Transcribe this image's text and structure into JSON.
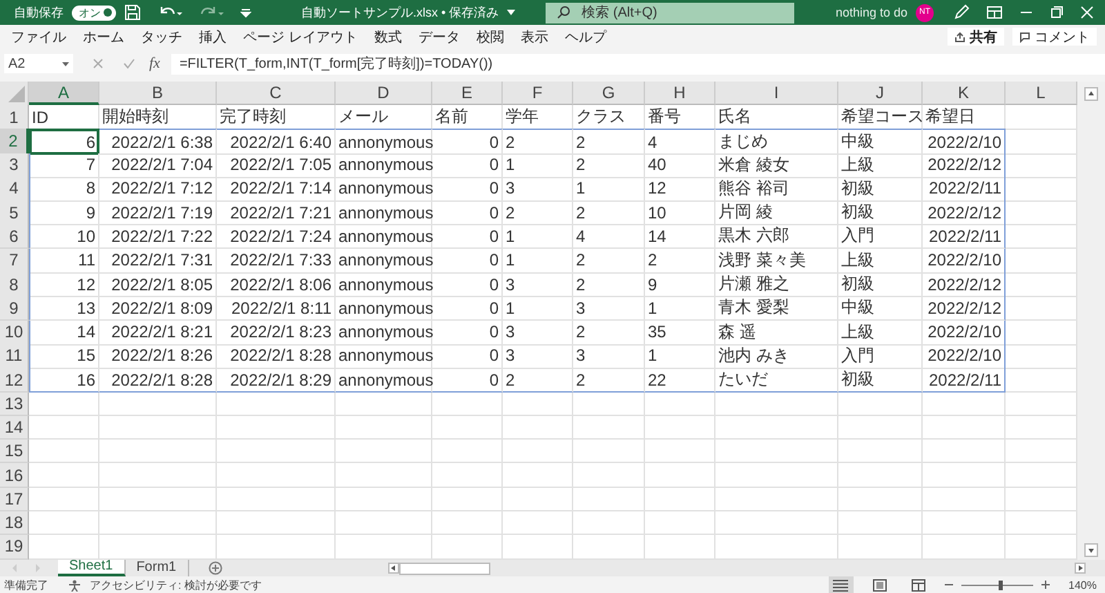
{
  "title_bar": {
    "autosave_label": "自動保存",
    "autosave_on": true,
    "toggle_label": "オン",
    "filename": "自動ソートサンプル.xlsx • 保存済み",
    "search_placeholder": "検索 (Alt+Q)",
    "user": "nothing to do",
    "avatar": "NT"
  },
  "ribbon": {
    "tabs": [
      "ファイル",
      "ホーム",
      "タッチ",
      "挿入",
      "ページ レイアウト",
      "数式",
      "データ",
      "校閲",
      "表示",
      "ヘルプ"
    ],
    "share": "共有",
    "comment": "コメント"
  },
  "formula_bar": {
    "name_box": "A2",
    "fx": "fx",
    "formula": "=FILTER(T_form,INT(T_form[完了時刻])=TODAY())"
  },
  "columns": [
    {
      "letter": "A",
      "kind": "number",
      "selected": true
    },
    {
      "letter": "B",
      "kind": "number",
      "selected": false
    },
    {
      "letter": "C",
      "kind": "number",
      "selected": false
    },
    {
      "letter": "D",
      "kind": "text",
      "selected": false
    },
    {
      "letter": "E",
      "kind": "number",
      "selected": false
    },
    {
      "letter": "F",
      "kind": "text",
      "selected": false
    },
    {
      "letter": "G",
      "kind": "text",
      "selected": false
    },
    {
      "letter": "H",
      "kind": "text",
      "selected": false
    },
    {
      "letter": "I",
      "kind": "text",
      "selected": false
    },
    {
      "letter": "J",
      "kind": "text",
      "selected": false
    },
    {
      "letter": "K",
      "kind": "number",
      "selected": false
    },
    {
      "letter": "L",
      "kind": "text",
      "selected": false
    }
  ],
  "rows": [
    {
      "number": "1",
      "selected": false,
      "in_spill": false,
      "cells": [
        "ID",
        "開始時刻",
        "完了時刻",
        "メール",
        "名前",
        "学年",
        "クラス",
        "番号",
        "氏名",
        "希望コース",
        "希望日"
      ],
      "header": true
    },
    {
      "number": "2",
      "selected": true,
      "in_spill": true,
      "cells": [
        "6",
        "2022/2/1 6:38",
        "2022/2/1 6:40",
        "annonymous",
        "0",
        "2",
        "2",
        "4",
        "まじめ",
        "中級",
        "2022/2/10"
      ]
    },
    {
      "number": "3",
      "selected": false,
      "in_spill": true,
      "cells": [
        "7",
        "2022/2/1 7:04",
        "2022/2/1 7:05",
        "annonymous",
        "0",
        "1",
        "2",
        "40",
        "米倉 綾女",
        "上級",
        "2022/2/12"
      ]
    },
    {
      "number": "4",
      "selected": false,
      "in_spill": true,
      "cells": [
        "8",
        "2022/2/1 7:12",
        "2022/2/1 7:14",
        "annonymous",
        "0",
        "3",
        "1",
        "12",
        "熊谷 裕司",
        "初級",
        "2022/2/11"
      ]
    },
    {
      "number": "5",
      "selected": false,
      "in_spill": true,
      "cells": [
        "9",
        "2022/2/1 7:19",
        "2022/2/1 7:21",
        "annonymous",
        "0",
        "2",
        "2",
        "10",
        "片岡 綾",
        "初級",
        "2022/2/12"
      ]
    },
    {
      "number": "6",
      "selected": false,
      "in_spill": true,
      "cells": [
        "10",
        "2022/2/1 7:22",
        "2022/2/1 7:24",
        "annonymous",
        "0",
        "1",
        "4",
        "14",
        "黒木 六郎",
        "入門",
        "2022/2/11"
      ]
    },
    {
      "number": "7",
      "selected": false,
      "in_spill": true,
      "cells": [
        "11",
        "2022/2/1 7:31",
        "2022/2/1 7:33",
        "annonymous",
        "0",
        "1",
        "2",
        "2",
        "浅野 菜々美",
        "上級",
        "2022/2/10"
      ]
    },
    {
      "number": "8",
      "selected": false,
      "in_spill": true,
      "cells": [
        "12",
        "2022/2/1 8:05",
        "2022/2/1 8:06",
        "annonymous",
        "0",
        "3",
        "2",
        "9",
        "片瀬 雅之",
        "初級",
        "2022/2/12"
      ]
    },
    {
      "number": "9",
      "selected": false,
      "in_spill": true,
      "cells": [
        "13",
        "2022/2/1 8:09",
        "2022/2/1 8:11",
        "annonymous",
        "0",
        "1",
        "3",
        "1",
        "青木 愛梨",
        "中級",
        "2022/2/12"
      ]
    },
    {
      "number": "10",
      "selected": false,
      "in_spill": true,
      "cells": [
        "14",
        "2022/2/1 8:21",
        "2022/2/1 8:23",
        "annonymous",
        "0",
        "3",
        "2",
        "35",
        "森 遥",
        "上級",
        "2022/2/10"
      ]
    },
    {
      "number": "11",
      "selected": false,
      "in_spill": true,
      "cells": [
        "15",
        "2022/2/1 8:26",
        "2022/2/1 8:28",
        "annonymous",
        "0",
        "3",
        "3",
        "1",
        "池内 みき",
        "入門",
        "2022/2/10"
      ]
    },
    {
      "number": "12",
      "selected": false,
      "in_spill": true,
      "cells": [
        "16",
        "2022/2/1 8:28",
        "2022/2/1 8:29",
        "annonymous",
        "0",
        "2",
        "2",
        "22",
        "たいだ",
        "初級",
        "2022/2/11"
      ]
    },
    {
      "number": "13",
      "selected": false,
      "in_spill": false
    },
    {
      "number": "14",
      "selected": false,
      "in_spill": false
    },
    {
      "number": "15",
      "selected": false,
      "in_spill": false
    },
    {
      "number": "16",
      "selected": false,
      "in_spill": false
    },
    {
      "number": "17",
      "selected": false,
      "in_spill": false
    },
    {
      "number": "18",
      "selected": false,
      "in_spill": false
    },
    {
      "number": "19",
      "selected": false,
      "in_spill": false
    }
  ],
  "sheet_tabs": [
    {
      "label": "Sheet1",
      "selected": true
    },
    {
      "label": "Form1",
      "selected": false
    }
  ],
  "status_bar": {
    "ready": "準備完了",
    "accessibility": "アクセシビリティ: 検討が必要です",
    "view_buttons": [
      {
        "kind": "normal",
        "selected": true
      },
      {
        "kind": "page_layout",
        "selected": false
      },
      {
        "kind": "page_break",
        "selected": false
      }
    ],
    "zoom": {
      "level": 0.55,
      "label": "140%"
    }
  }
}
